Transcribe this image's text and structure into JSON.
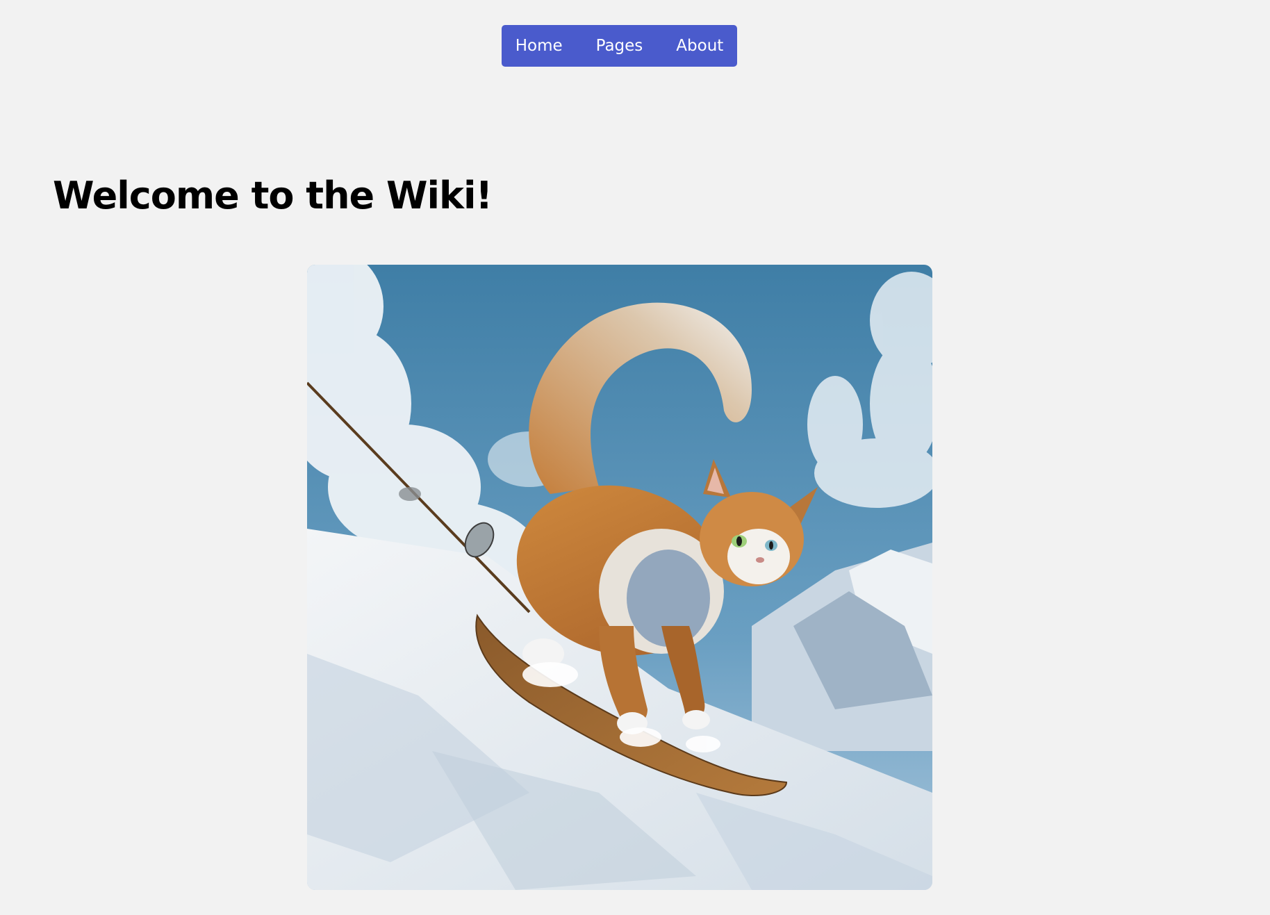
{
  "nav": {
    "items": [
      {
        "label": "Home"
      },
      {
        "label": "Pages"
      },
      {
        "label": "About"
      }
    ],
    "background": "#4a5bcc",
    "text_color": "#ffffff"
  },
  "main": {
    "title": "Welcome to the Wiki!"
  },
  "hero_image": {
    "subject": "cat-skiing-illustration",
    "sky_color": "#4d86ad",
    "snow_color": "#e9eef2"
  },
  "page": {
    "background": "#f2f2f2"
  }
}
